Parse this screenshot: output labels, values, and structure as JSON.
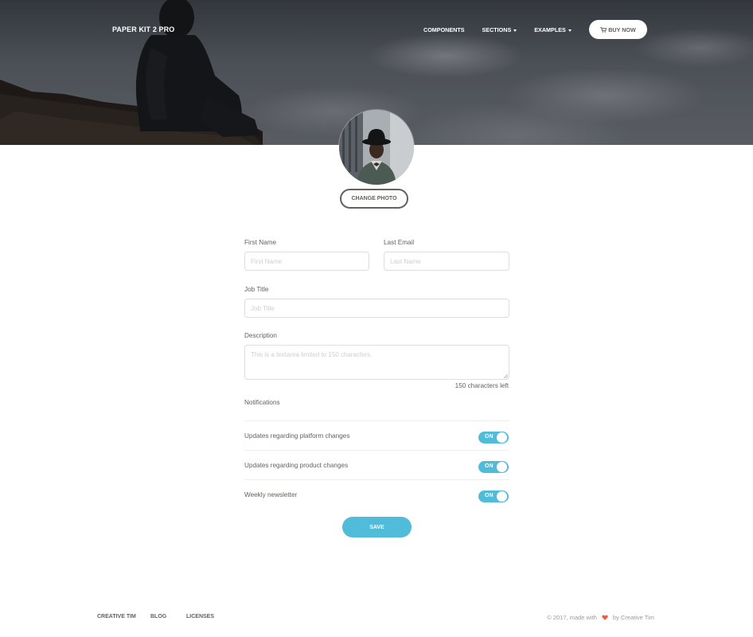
{
  "navbar": {
    "brand": "PAPER KIT 2 PRO",
    "links": [
      {
        "label": "COMPONENTS",
        "has_caret": false
      },
      {
        "label": "SECTIONS",
        "has_caret": true
      },
      {
        "label": "EXAMPLES",
        "has_caret": true
      }
    ],
    "buy_button": {
      "label": "BUY NOW",
      "icon": "cart-icon"
    }
  },
  "profile": {
    "change_photo_label": "CHANGE PHOTO"
  },
  "form": {
    "first_name": {
      "label": "First Name",
      "placeholder": "First Name",
      "value": ""
    },
    "last_name": {
      "label": "Last Email",
      "placeholder": "Last Name",
      "value": ""
    },
    "job_title": {
      "label": "Job Title",
      "placeholder": "Job Title",
      "value": ""
    },
    "description": {
      "label": "Description",
      "placeholder": "This is a textarea limited to 150 characters.",
      "value": ""
    },
    "chars_left": "150 characters left"
  },
  "notifications": {
    "title": "Notifications",
    "items": [
      {
        "label": "Updates regarding platform changes",
        "switch_text": "ON",
        "enabled": true
      },
      {
        "label": "Updates regarding product changes",
        "switch_text": "ON",
        "enabled": true
      },
      {
        "label": "Weekly newsletter",
        "switch_text": "ON",
        "enabled": true
      }
    ]
  },
  "save_label": "SAVE",
  "footer": {
    "links": [
      "CREATIVE TIM",
      "BLOG",
      "LICENSES"
    ],
    "copyright_prefix": "© 2017, made with",
    "copyright_suffix": "by Creative Tim",
    "heart_icon": "heart-icon"
  },
  "colors": {
    "accent": "#51bcda",
    "text": "#66615b",
    "heart": "#f5593d"
  }
}
